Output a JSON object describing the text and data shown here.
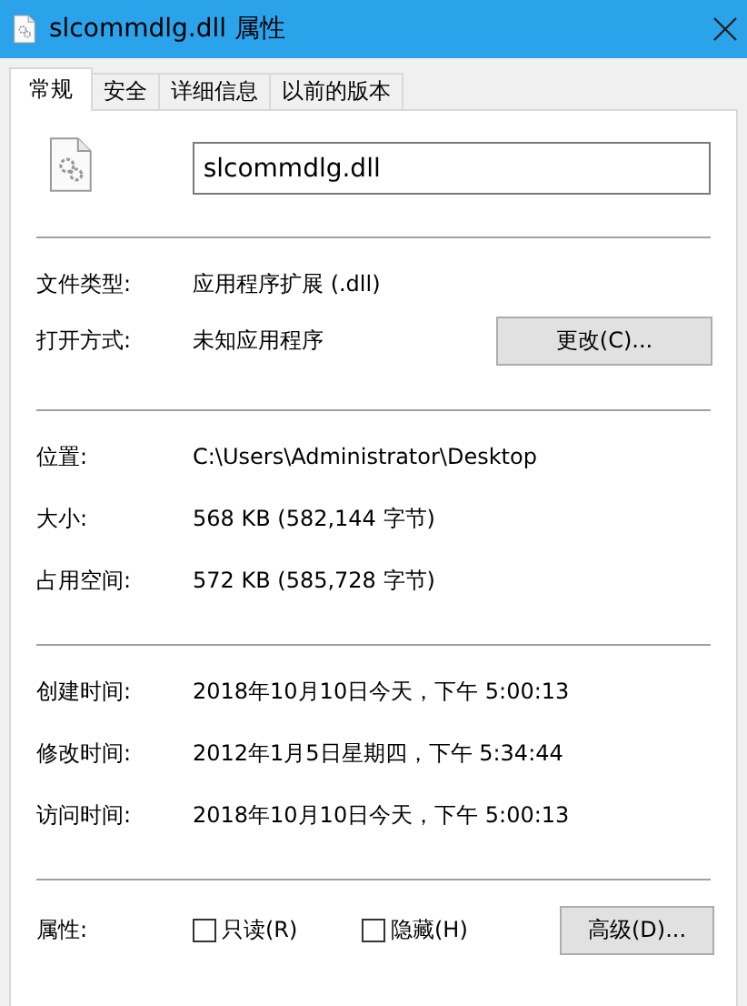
{
  "window": {
    "title": "slcommdlg.dll 属性"
  },
  "tabs": [
    {
      "label": "常规",
      "selected": true
    },
    {
      "label": "安全",
      "selected": false
    },
    {
      "label": "详细信息",
      "selected": false
    },
    {
      "label": "以前的版本",
      "selected": false
    }
  ],
  "file_name": {
    "value": "slcommdlg.dll"
  },
  "sections": [
    {
      "rows": [
        {
          "label": "文件类型:",
          "value": "应用程序扩展 (.dll)"
        },
        {
          "label": "打开方式:",
          "value": "未知应用程序",
          "button": "更改(C)..."
        }
      ]
    },
    {
      "rows": [
        {
          "label": "位置:",
          "value": "C:\\Users\\Administrator\\Desktop"
        },
        {
          "label": "大小:",
          "value": "568 KB (582,144 字节)"
        },
        {
          "label": "占用空间:",
          "value": "572 KB (585,728 字节)"
        }
      ]
    },
    {
      "rows": [
        {
          "label": "创建时间:",
          "value": "2018年10月10日今天，下午 5:00:13"
        },
        {
          "label": "修改时间:",
          "value": "2012年1月5日星期四，下午 5:34:44"
        },
        {
          "label": "访问时间:",
          "value": "2018年10月10日今天，下午 5:00:13"
        }
      ]
    }
  ],
  "attributes": {
    "label": "属性:",
    "checkboxes": [
      {
        "label": "只读(R)",
        "checked": false
      },
      {
        "label": "隐藏(H)",
        "checked": false
      }
    ],
    "button": "高级(D)..."
  }
}
